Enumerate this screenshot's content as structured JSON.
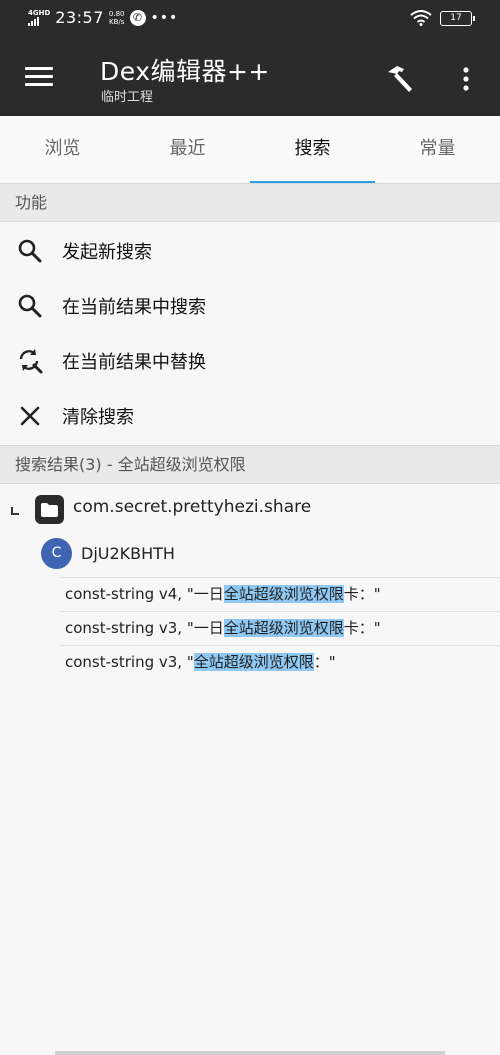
{
  "status_bar": {
    "network": "4GHD",
    "time": "23:57",
    "speed_value": "0.80",
    "speed_unit": "KB/s",
    "more": "•••",
    "battery": "17"
  },
  "toolbar": {
    "title": "Dex编辑器++",
    "subtitle": "临时工程",
    "icons": [
      "menu-icon",
      "hammer-icon",
      "more-vert-icon"
    ]
  },
  "tabs": [
    {
      "label": "浏览",
      "active": false
    },
    {
      "label": "最近",
      "active": false
    },
    {
      "label": "搜索",
      "active": true
    },
    {
      "label": "常量",
      "active": false
    }
  ],
  "functions": {
    "header": "功能",
    "items": [
      {
        "label": "发起新搜索",
        "icon": "search-icon"
      },
      {
        "label": "在当前结果中搜索",
        "icon": "search-icon"
      },
      {
        "label": "在当前结果中替换",
        "icon": "replace-icon"
      },
      {
        "label": "清除搜索",
        "icon": "close-icon"
      }
    ]
  },
  "results": {
    "header": "搜索结果(3) - 全站超级浏览权限",
    "package": "com.secret.prettyhezi.share",
    "class_badge": "C",
    "class_name": "DjU2KBHTH",
    "rows": [
      {
        "pre": "const-string v4, \"一日",
        "match": "全站超级浏览权限",
        "post": "卡：\""
      },
      {
        "pre": "const-string v3, \"一日",
        "match": "全站超级浏览权限",
        "post": "卡：\""
      },
      {
        "pre": "const-string v3, \"",
        "match": "全站超级浏览权限",
        "post": "：\""
      }
    ]
  },
  "colors": {
    "toolbar_bg": "#2b2b2b",
    "tab_indicator": "#2e9de6",
    "highlight": "#8ec8f3",
    "class_badge": "#3f64b1"
  }
}
